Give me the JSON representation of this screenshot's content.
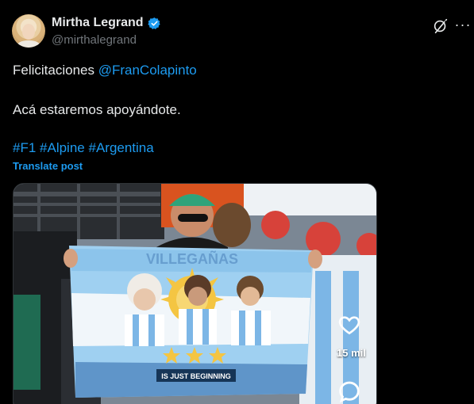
{
  "post": {
    "author": {
      "display_name": "Mirtha Legrand",
      "handle": "@mirthalegrand",
      "verified": true
    },
    "body": {
      "line1_text": "Felicitaciones ",
      "line1_mention": "@FranColapinto",
      "line2": "Acá estaremos apoyándote.",
      "hashtags": [
        "#F1",
        "#Alpine",
        "#Argentina"
      ]
    },
    "translate_label": "Translate post",
    "media": {
      "banner_top_text": "VILLEGAÑAS",
      "banner_bottom_text": "IS JUST BEGINNING",
      "overlay_like_count": "15 mil"
    },
    "icons": [
      "verified-badge-icon",
      "grok-icon",
      "more-icon",
      "heart-icon",
      "reply-icon"
    ]
  },
  "colors": {
    "background": "#000000",
    "text": "#e7e9ea",
    "secondary": "#71767b",
    "accent": "#1d9bf0"
  }
}
